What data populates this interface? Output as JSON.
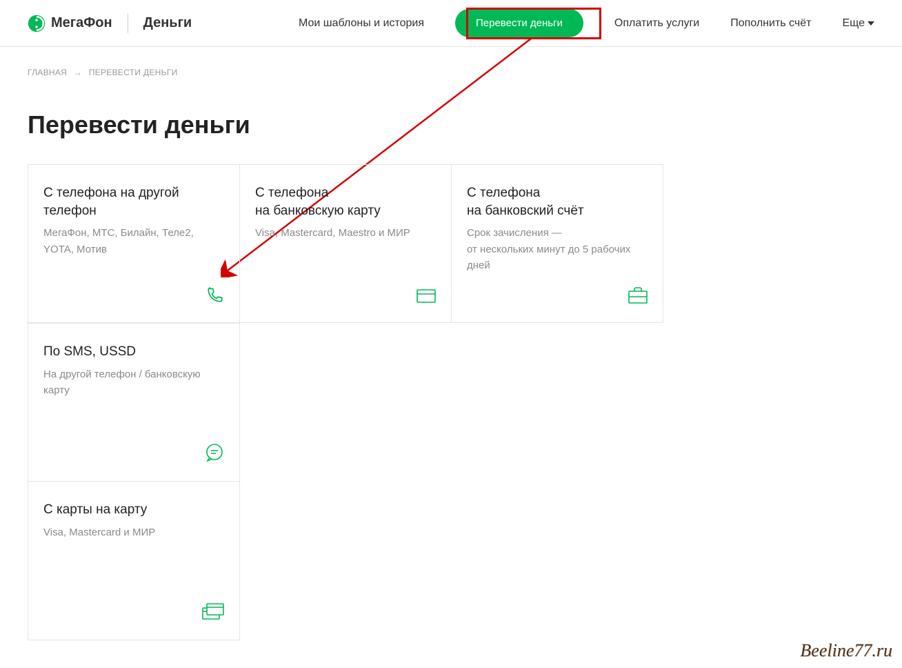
{
  "brand": "МегаФон",
  "section": "Деньги",
  "nav": {
    "templates": "Мои шаблоны и история",
    "transfer": "Перевести деньги",
    "pay": "Оплатить услуги",
    "topup": "Пополнить счёт",
    "more": "Еще"
  },
  "breadcrumb": {
    "home": "ГЛАВНАЯ",
    "current": "ПЕРЕВЕСТИ ДЕНЬГИ"
  },
  "title": "Перевести деньги",
  "cards": [
    {
      "title": "С телефона на другой телефон",
      "desc": "МегаФон, МТС, Билайн, Теле2, YOTA, Мотив"
    },
    {
      "title": "С телефона\nна банковскую карту",
      "desc": "Visa, Mastercard, Maestro и МИР"
    },
    {
      "title": "С телефона\nна банковский счёт",
      "desc": "Срок зачисления —\nот нескольких минут до 5 рабочих дней"
    },
    {
      "title": "По SMS, USSD",
      "desc": "На другой телефон / банковскую карту"
    },
    {
      "title": "С карты на карту",
      "desc": "Visa, Mastercard и МИР"
    }
  ],
  "watermark": "Beeline77.ru"
}
